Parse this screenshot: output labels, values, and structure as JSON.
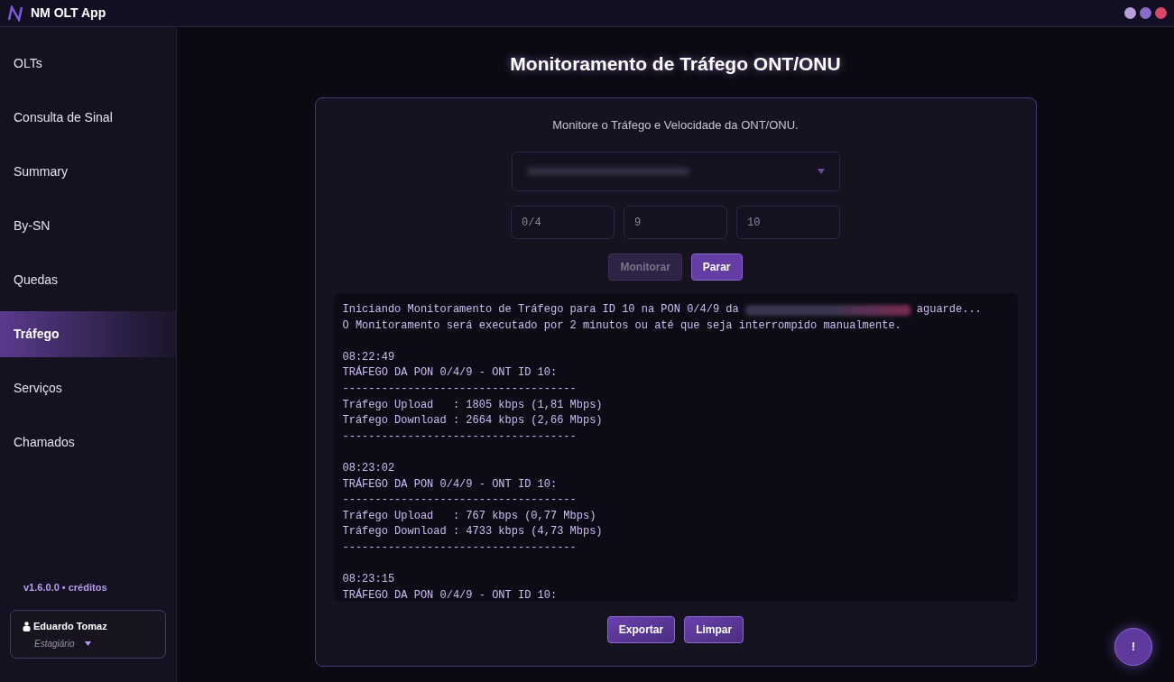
{
  "window": {
    "title": "NM OLT App",
    "controls": [
      {
        "color": "#b9a0dc"
      },
      {
        "color": "#8a6cc8"
      },
      {
        "color": "#d9486a"
      }
    ]
  },
  "sidebar": {
    "items": [
      {
        "label": "OLTs",
        "selected": false
      },
      {
        "label": "Consulta de Sinal",
        "selected": false
      },
      {
        "label": "Summary",
        "selected": false
      },
      {
        "label": "By-SN",
        "selected": false
      },
      {
        "label": "Quedas",
        "selected": false
      },
      {
        "label": "Tráfego",
        "selected": true
      },
      {
        "label": "Serviços",
        "selected": false
      },
      {
        "label": "Chamados",
        "selected": false
      }
    ],
    "version": "v1.6.0.0 • créditos",
    "user": {
      "name": "Eduardo Tomaz",
      "role": "Estagiário"
    }
  },
  "page": {
    "title": "Monitoramento de Tráfego ONT/ONU",
    "subtitle": "Monitore o Tráfego e Velocidade da ONT/ONU.",
    "fields": [
      {
        "value": "0/4"
      },
      {
        "value": "9"
      },
      {
        "value": "10"
      }
    ],
    "buttons": [
      {
        "label": "Monitorar",
        "disabled": true
      },
      {
        "label": "Parar",
        "disabled": false
      }
    ],
    "log": {
      "intro_before": "Iniciando Monitoramento de Tráfego para ID 10 na PON 0/4/9 da",
      "intro_after": "aguarde...",
      "intro_line2": "O Monitoramento será executado por 2 minutos ou até que seja interrompido manualmente.",
      "blocks": [
        [
          "08:22:49",
          "TRÁFEGO DA PON 0/4/9 - ONT ID 10:",
          "------------------------------------",
          "Tráfego Upload   : 1805 kbps (1,81 Mbps)",
          "Tráfego Download : 2664 kbps (2,66 Mbps)",
          "------------------------------------"
        ],
        [
          "08:23:02",
          "TRÁFEGO DA PON 0/4/9 - ONT ID 10:",
          "------------------------------------",
          "Tráfego Upload   : 767 kbps (0,77 Mbps)",
          "Tráfego Download : 4733 kbps (4,73 Mbps)",
          "------------------------------------"
        ],
        [
          "08:23:15",
          "TRÁFEGO DA PON 0/4/9 - ONT ID 10:"
        ]
      ]
    },
    "actions": [
      {
        "label": "Exportar"
      },
      {
        "label": "Limpar"
      }
    ]
  },
  "help_button": {
    "label": "!"
  }
}
